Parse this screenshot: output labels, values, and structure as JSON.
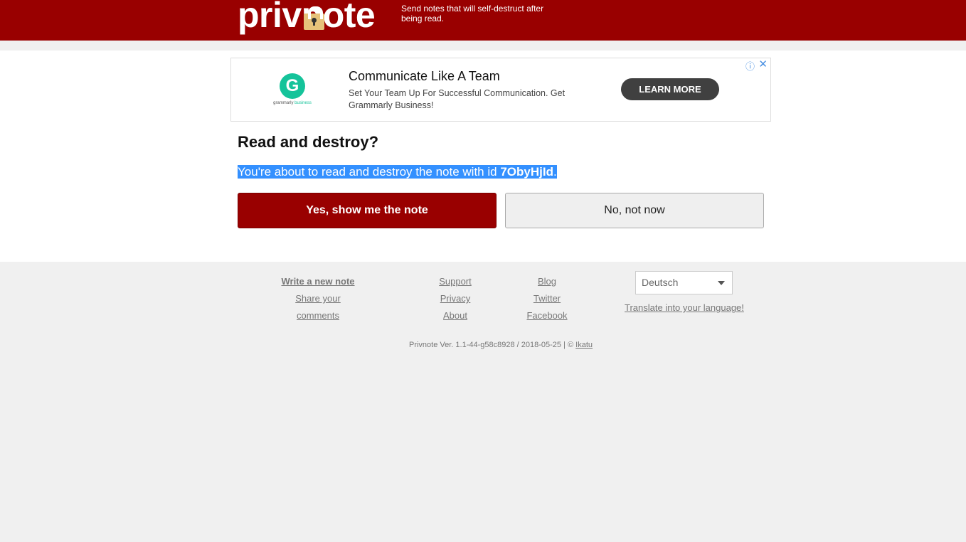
{
  "header": {
    "logo_text": "privnote",
    "tagline": "Send notes that will self-destruct after being read."
  },
  "ad": {
    "brand": "grammarly",
    "brand_sub": "business",
    "logo_letter": "G",
    "title": "Communicate Like A Team",
    "description": "Set Your Team Up For Successful Communication. Get Grammarly Business!",
    "cta": "LEARN MORE",
    "info_icon": "ⓘ",
    "close_icon": "✕"
  },
  "main": {
    "heading": "Read and destroy?",
    "message_prefix": "You're about to read and destroy the note with id ",
    "note_id": "7ObyHjId",
    "message_suffix": ".",
    "yes_label": "Yes, show me the note",
    "no_label": "No, not now"
  },
  "footer": {
    "col1": [
      "Write a new note",
      "Share your comments"
    ],
    "col2": [
      "Support",
      "Privacy",
      "About"
    ],
    "col3": [
      "Blog",
      "Twitter",
      "Facebook"
    ],
    "language": "Deutsch",
    "translate": "Translate into your language!",
    "version_text": "Privnote Ver. 1.1-44-g58c8928 / 2018-05-25 | © ",
    "version_link": "Ikatu"
  }
}
